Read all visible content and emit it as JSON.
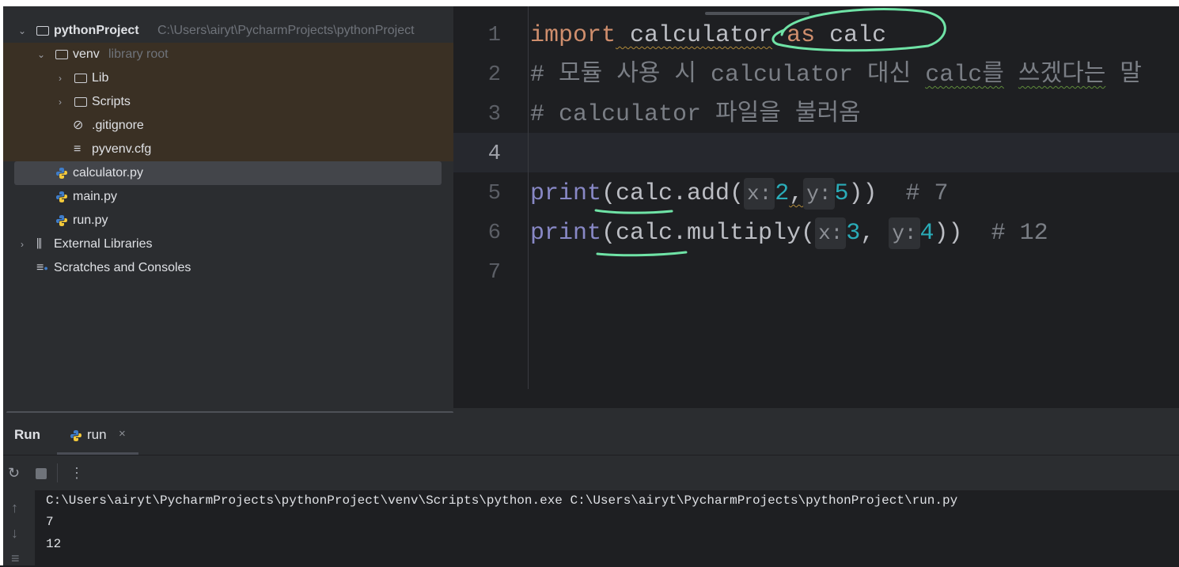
{
  "project": {
    "root": {
      "name": "pythonProject",
      "path": "C:\\Users\\airyt\\PycharmProjects\\pythonProject"
    },
    "venv": {
      "name": "venv",
      "hint": "library root"
    },
    "items": {
      "lib": "Lib",
      "scripts": "Scripts",
      "gitignore": ".gitignore",
      "pyvenv": "pyvenv.cfg",
      "calculator": "calculator.py",
      "main": "main.py",
      "run": "run.py",
      "external": "External Libraries",
      "scratches": "Scratches and Consoles"
    }
  },
  "editor": {
    "line_numbers": [
      "1",
      "2",
      "3",
      "4",
      "5",
      "6",
      "7"
    ],
    "current_line": 4,
    "line1": {
      "kw_import": "import",
      "module": " calculator",
      "kw_as": " as",
      "alias": " calc"
    },
    "line2": {
      "p1": "# 모듈 사용 시 calculator 대신 ",
      "p2": "calc를",
      "p3": " ",
      "p4": "쓰겠다는",
      "p5": " 말"
    },
    "line3": {
      "text": "# calculator 파일을 불러옴"
    },
    "line5": {
      "print": "print",
      "open": "(calc.add(",
      "x_hint": "x:",
      "x_val": "2",
      "comma": ",",
      "y_hint": "y:",
      "y_val": "5",
      "close": "))",
      "comment": "  # 7"
    },
    "line6": {
      "print": "print",
      "open": "(calc.multiply(",
      "x_hint": "x:",
      "x_val": "3",
      "comma": ", ",
      "y_hint": "y:",
      "y_val": "4",
      "close": "))",
      "comment": "  # 12"
    }
  },
  "run_panel": {
    "title": "Run",
    "tab_label": "run",
    "tab_close": "×",
    "console_lines": [
      "C:\\Users\\airyt\\PycharmProjects\\pythonProject\\venv\\Scripts\\python.exe C:\\Users\\airyt\\PycharmProjects\\pythonProject\\run.py",
      "7",
      "12"
    ]
  },
  "icons": {
    "rerun": "rerun-icon",
    "stop": "stop-icon",
    "more": "more-icon",
    "up": "scroll-up-icon",
    "down": "scroll-down-icon",
    "wrap": "soft-wrap-icon"
  },
  "colors": {
    "annotation": "#6fe3a6",
    "keyword": "#cf8e6d",
    "number": "#2aacb8",
    "builtin": "#8888c6"
  }
}
